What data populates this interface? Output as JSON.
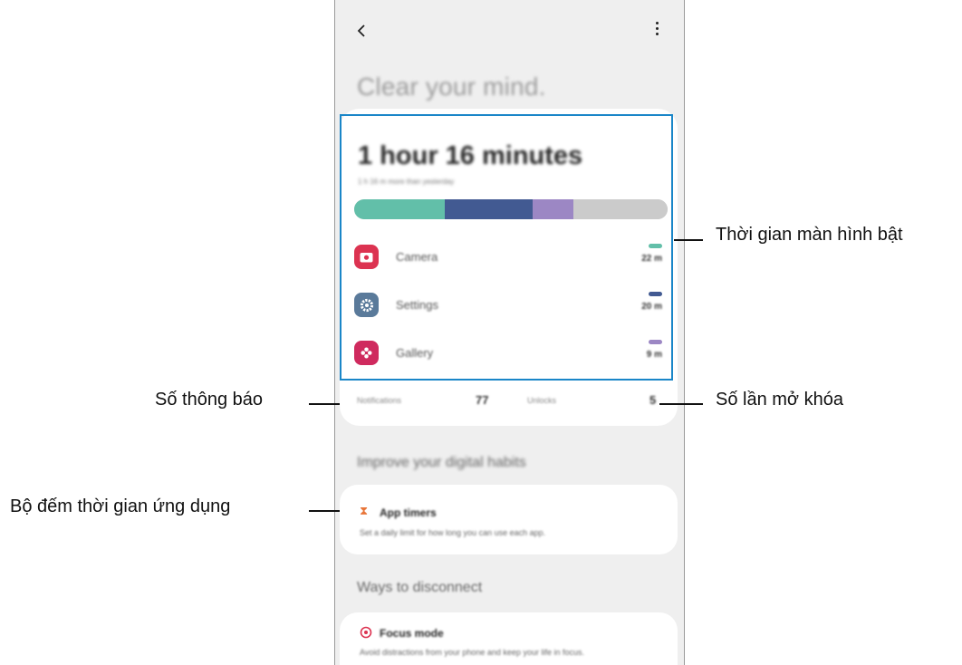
{
  "header": {
    "back_icon": "back-arrow-icon",
    "more_icon": "more-vert-icon"
  },
  "headline": "Clear your mind.",
  "usage": {
    "total": "1 hour 16 minutes",
    "subtitle": "1 h 16 m more than yesterday",
    "segments": [
      {
        "color": "#62bfa9",
        "fraction": 0.29
      },
      {
        "color": "#425a92",
        "fraction": 0.28
      },
      {
        "color": "#9c87c4",
        "fraction": 0.13
      },
      {
        "color": "#cbcbcb",
        "fraction": 0.3
      }
    ],
    "apps": [
      {
        "name": "Camera",
        "time": "22 m",
        "icon": "camera-icon",
        "icon_color": "#dc3351",
        "pill_color": "#62bfa9"
      },
      {
        "name": "Settings",
        "time": "20 m",
        "icon": "gear-icon",
        "icon_color": "#5a7a9a",
        "pill_color": "#425a92"
      },
      {
        "name": "Gallery",
        "time": "9 m",
        "icon": "flower-icon",
        "icon_color": "#cf2a5e",
        "pill_color": "#9c87c4"
      }
    ]
  },
  "stats": {
    "notifications_label": "Notifications",
    "notifications_value": "77",
    "unlocks_label": "Unlocks",
    "unlocks_value": "5"
  },
  "sections": {
    "habits": "Improve your digital habits",
    "disconnect": "Ways to disconnect"
  },
  "app_timers": {
    "title": "App timers",
    "desc": "Set a daily limit for how long you can use each app.",
    "icon": "hourglass-icon"
  },
  "focus_mode": {
    "title": "Focus mode",
    "desc": "Avoid distractions from your phone and keep your life in focus.",
    "icon": "target-icon"
  },
  "annotations": {
    "screen_time": "Thời gian màn hình bật",
    "notifications": "Số thông báo",
    "unlocks": "Số lần mở khóa",
    "app_timers": "Bộ đếm thời gian ứng dụng"
  },
  "colors": {
    "highlight": "#1a86c8",
    "accent_orange": "#e8763a",
    "accent_red": "#dc3351"
  }
}
